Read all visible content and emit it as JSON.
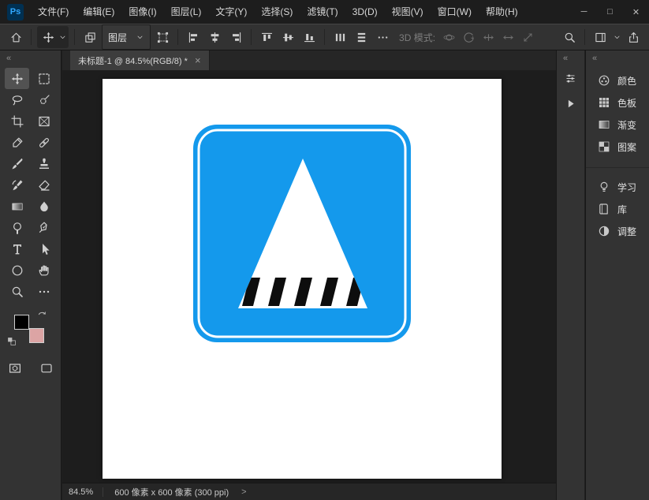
{
  "window": {
    "logo_text": "Ps",
    "menus": [
      {
        "id": "file",
        "label": "文件(F)"
      },
      {
        "id": "edit",
        "label": "编辑(E)"
      },
      {
        "id": "image",
        "label": "图像(I)"
      },
      {
        "id": "layer",
        "label": "图层(L)"
      },
      {
        "id": "type",
        "label": "文字(Y)"
      },
      {
        "id": "select",
        "label": "选择(S)"
      },
      {
        "id": "filter",
        "label": "滤镜(T)"
      },
      {
        "id": "3d",
        "label": "3D(D)"
      },
      {
        "id": "view",
        "label": "视图(V)"
      },
      {
        "id": "window",
        "label": "窗口(W)"
      },
      {
        "id": "help",
        "label": "帮助(H)"
      }
    ],
    "controls": [
      {
        "id": "minimize",
        "glyph": "─"
      },
      {
        "id": "maximize",
        "glyph": "□"
      },
      {
        "id": "close",
        "glyph": "✕"
      }
    ]
  },
  "options_bar": {
    "layer_target_label": "图层",
    "mode_label": "3D 模式:"
  },
  "left_dock": {
    "collapse_glyph": "«"
  },
  "toolbar": {
    "selected_tool": "move",
    "foreground_color": "#000000",
    "background_color": "#dca4a4",
    "tools": [
      {
        "id": "move",
        "icon": "move-tool-icon",
        "selected": true
      },
      {
        "id": "rectangular-marquee",
        "icon": "marquee-tool-icon"
      },
      {
        "id": "lasso",
        "icon": "lasso-tool-icon"
      },
      {
        "id": "quick-selection",
        "icon": "quick-selection-tool-icon"
      },
      {
        "id": "crop",
        "icon": "crop-tool-icon"
      },
      {
        "id": "frame",
        "icon": "frame-tool-icon"
      },
      {
        "id": "eyedropper",
        "icon": "eyedropper-tool-icon"
      },
      {
        "id": "spot-healing",
        "icon": "healing-brush-tool-icon"
      },
      {
        "id": "brush",
        "icon": "brush-tool-icon"
      },
      {
        "id": "clone-stamp",
        "icon": "clone-stamp-tool-icon"
      },
      {
        "id": "history-brush",
        "icon": "history-brush-tool-icon"
      },
      {
        "id": "eraser",
        "icon": "eraser-tool-icon"
      },
      {
        "id": "gradient",
        "icon": "gradient-tool-icon"
      },
      {
        "id": "blur",
        "icon": "blur-tool-icon"
      },
      {
        "id": "dodge",
        "icon": "dodge-tool-icon"
      },
      {
        "id": "pen",
        "icon": "pen-tool-icon"
      },
      {
        "id": "horizontal-type",
        "icon": "type-tool-icon"
      },
      {
        "id": "path-selection",
        "icon": "path-selection-tool-icon"
      },
      {
        "id": "ellipse",
        "icon": "ellipse-tool-icon"
      },
      {
        "id": "hand",
        "icon": "hand-tool-icon"
      },
      {
        "id": "zoom",
        "icon": "zoom-tool-icon"
      },
      {
        "id": "more-tools",
        "icon": "ellipsis-icon"
      }
    ]
  },
  "document": {
    "tab_title": "未标题-1 @ 84.5%(RGB/8) *",
    "close_glyph": "×"
  },
  "artwork": {
    "type": "road-sign",
    "sign_blue": "#1499ec",
    "sign_border": "#ffffff",
    "triangle_fill": "#ffffff",
    "stripe_color": "#0d0d0d",
    "stripe_count": 5
  },
  "status_bar": {
    "zoom": "84.5%",
    "doc_info": "600 像素 x 600 像素 (300 ppi)",
    "chevron": ">"
  },
  "right_dock": {
    "collapse_glyph": "«",
    "strip_icons": [
      {
        "id": "properties",
        "icon": "properties-panel-icon"
      },
      {
        "id": "actions",
        "icon": "actions-panel-icon"
      }
    ],
    "groups": [
      {
        "items": [
          {
            "id": "color",
            "label": "颜色",
            "icon": "color-icon"
          },
          {
            "id": "swatches",
            "label": "色板",
            "icon": "swatches-icon"
          },
          {
            "id": "gradients",
            "label": "渐变",
            "icon": "gradient-icon"
          },
          {
            "id": "patterns",
            "label": "图案",
            "icon": "pattern-icon"
          }
        ]
      },
      {
        "items": [
          {
            "id": "learn",
            "label": "学习",
            "icon": "learn-icon"
          },
          {
            "id": "libraries",
            "label": "库",
            "icon": "libraries-icon"
          },
          {
            "id": "adjustments",
            "label": "调整",
            "icon": "adjustments-icon"
          }
        ]
      }
    ]
  }
}
